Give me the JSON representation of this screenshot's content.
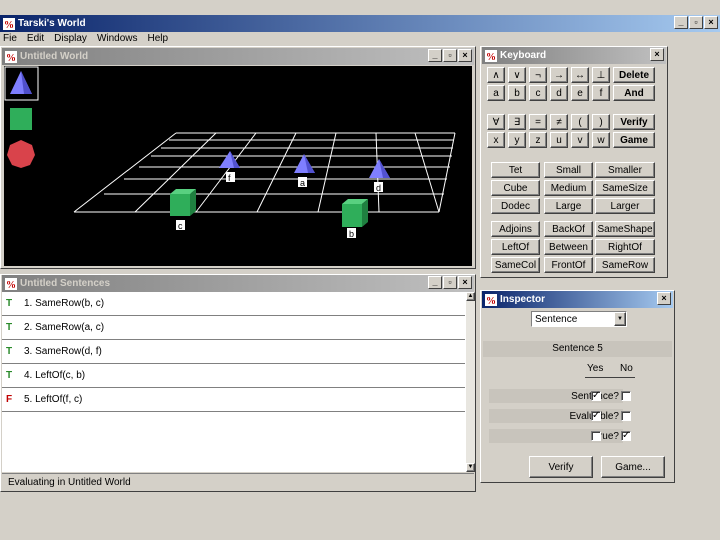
{
  "app": {
    "title": "Tarski's World"
  },
  "menu": [
    "Fie",
    "Edit",
    "Display",
    "Windows",
    "Help"
  ],
  "world_window": {
    "title": "Untitled World"
  },
  "palette": [
    "tetrahedron-tool",
    "cube-tool",
    "dodecahedron-tool"
  ],
  "world_labels": {
    "tet1": "f",
    "tet2": "a",
    "tet3": "d",
    "cube1": "c",
    "cube2": "b"
  },
  "keyboard": {
    "title": "Keyboard",
    "row1": [
      "∧",
      "∨",
      "¬",
      "→",
      "↔",
      "⊥",
      "Delete"
    ],
    "row2": [
      "a",
      "b",
      "c",
      "d",
      "e",
      "f",
      "And"
    ],
    "row3": [
      "∀",
      "∃",
      "=",
      "≠",
      "(",
      ")",
      "Verify"
    ],
    "row4": [
      "x",
      "y",
      "z",
      "u",
      "v",
      "w",
      "Game"
    ],
    "preds": [
      [
        "Tet",
        "Small",
        "Smaller"
      ],
      [
        "Cube",
        "Medium",
        "SameSize"
      ],
      [
        "Dodec",
        "Large",
        "Larger"
      ],
      [
        "Adjoins",
        "BackOf",
        "SameShape"
      ],
      [
        "LeftOf",
        "Between",
        "RightOf"
      ],
      [
        "SameCol",
        "FrontOf",
        "SameRow"
      ]
    ]
  },
  "sentences_window": {
    "title": "Untitled Sentences",
    "items": [
      {
        "mark": "T",
        "text": "1. SameRow(b, c)"
      },
      {
        "mark": "T",
        "text": "2. SameRow(a, c)"
      },
      {
        "mark": "T",
        "text": "3. SameRow(d, f)"
      },
      {
        "mark": "T",
        "text": "4. LeftOf(c, b)"
      },
      {
        "mark": "F",
        "text": "5. LeftOf(f, c)"
      }
    ],
    "status": "Evaluating in Untitled World"
  },
  "inspector": {
    "title": "Inspector",
    "select_value": "Sentence",
    "header": "Sentence 5",
    "col_yes": "Yes",
    "col_no": "No",
    "rows": [
      {
        "label": "Sentence?",
        "yes": true,
        "no": false
      },
      {
        "label": "Evaluable?",
        "yes": true,
        "no": false
      },
      {
        "label": "True?",
        "yes": false,
        "no": true
      }
    ],
    "verify_label": "Verify",
    "game_label": "Game..."
  },
  "colors": {
    "tet": "#7f7fff",
    "cube": "#2fae5a",
    "dodec": "#d9434b",
    "titlebar": "#0a246a"
  }
}
